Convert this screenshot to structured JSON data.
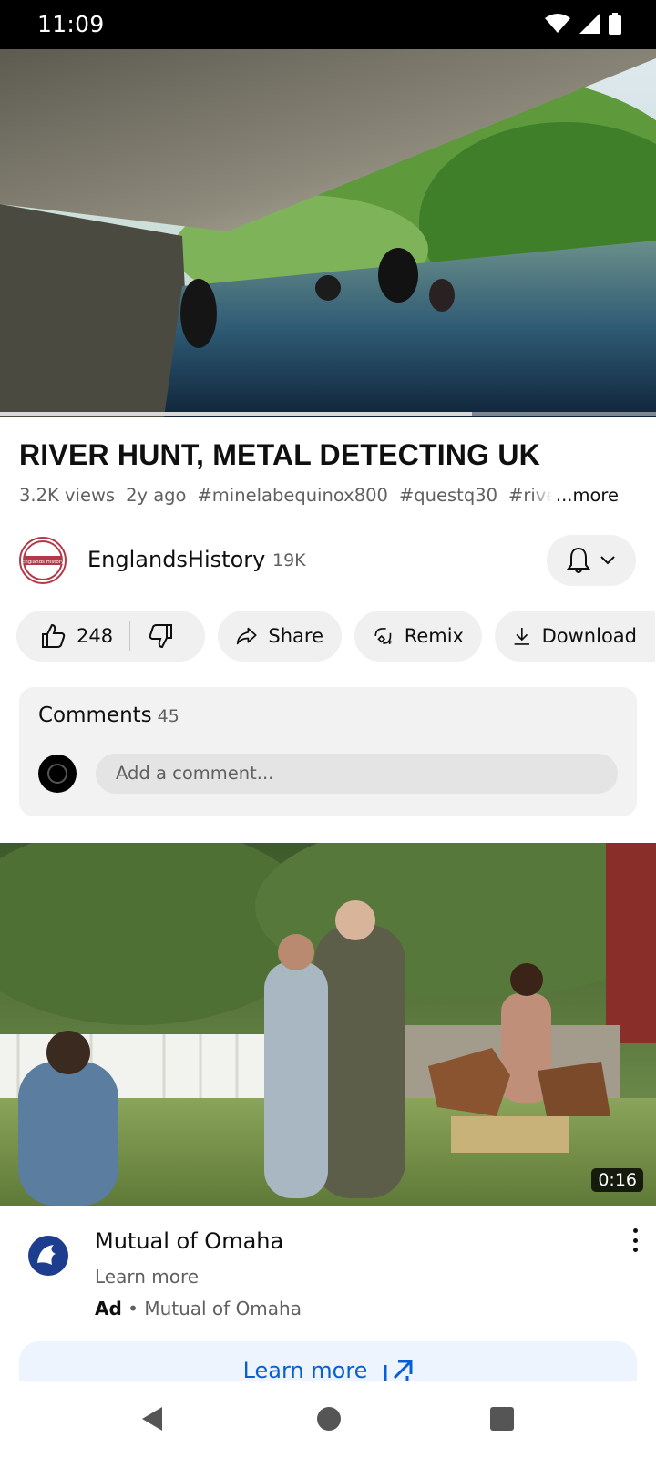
{
  "status_bar": {
    "time": "11:09"
  },
  "video": {
    "title": "RIVER HUNT, METAL DETECTING UK",
    "progress_fraction": 0.71,
    "buffer_fraction": 0.72,
    "meta": {
      "views": "3.2K views",
      "age": "2y ago",
      "hashtags": [
        "#minelabequinox800",
        "#questq30",
        "#river"
      ],
      "more": "...more"
    }
  },
  "channel": {
    "name": "EnglandsHistory",
    "subscribers": "19K",
    "avatar_text": "Englands History"
  },
  "actions": {
    "likes": "248",
    "share": "Share",
    "remix": "Remix",
    "download": "Download"
  },
  "comments": {
    "label": "Comments",
    "count": "45",
    "placeholder": "Add a comment..."
  },
  "ad": {
    "duration": "0:16",
    "title": "Mutual of Omaha",
    "subtitle": "Learn more",
    "ad_label": "Ad",
    "advertiser": "Mutual of Omaha",
    "cta": "Learn more"
  },
  "colors": {
    "progress": "#ff0000",
    "link_blue": "#065fd4",
    "chip_bg": "#f0f0f0"
  },
  "icons": [
    "wifi-icon",
    "signal-icon",
    "battery-icon",
    "bell-icon",
    "chevron-down-icon",
    "thumbs-up-icon",
    "thumbs-down-icon",
    "share-icon",
    "remix-icon",
    "download-icon",
    "more-vert-icon",
    "external-link-icon",
    "nav-back-icon",
    "nav-home-icon",
    "nav-recents-icon"
  ]
}
